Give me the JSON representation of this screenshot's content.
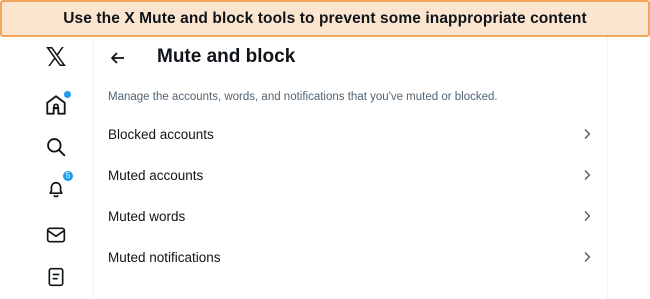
{
  "banner": {
    "text": "Use the X Mute and block tools to prevent some inappropriate content"
  },
  "nav": {
    "logo": "𝕏",
    "items": [
      {
        "icon": "home-icon",
        "has_dot": true
      },
      {
        "icon": "search-icon"
      },
      {
        "icon": "notifications-icon",
        "badge": "5"
      },
      {
        "icon": "messages-icon"
      },
      {
        "icon": "lists-icon"
      }
    ]
  },
  "header": {
    "title": "Mute and block",
    "back_icon": "back-arrow-icon"
  },
  "description": "Manage the accounts, words, and notifications that you've muted or blocked.",
  "menu": [
    {
      "label": "Blocked accounts"
    },
    {
      "label": "Muted accounts"
    },
    {
      "label": "Muted words"
    },
    {
      "label": "Muted notifications"
    }
  ],
  "colors": {
    "accent": "#1d9bf0",
    "banner_bg": "#fbe5cf",
    "banner_border": "#f2a65a",
    "secondary_text": "#536471"
  }
}
